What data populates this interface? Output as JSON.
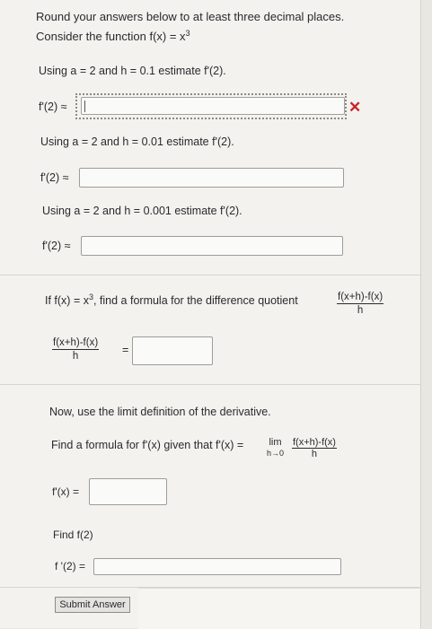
{
  "intro": {
    "line1": "Round your answers below to at least three decimal places.",
    "line2_prefix": "Consider the function f(x) = x",
    "line2_exp": "3"
  },
  "part1": {
    "prompt": "Using a = 2 and h = 0.1 estimate f'(2).",
    "label": "f'(2) ≈",
    "value": "",
    "status_icon": "x-mark",
    "status_color": "#c8232c"
  },
  "part2": {
    "prompt": "Using a = 2 and h = 0.01 estimate f'(2).",
    "label": "f'(2) ≈",
    "value": ""
  },
  "part3": {
    "prompt": "Using a = 2 and h = 0.001 estimate f'(2).",
    "label": "f'(2) ≈",
    "value": ""
  },
  "part4": {
    "prompt_prefix": "If f(x) = x",
    "prompt_exp": "3",
    "prompt_suffix": ", find a formula for the difference quotient",
    "dq_num": "f(x+h)-f(x)",
    "dq_den": "h",
    "equals": "=",
    "value": ""
  },
  "part5": {
    "intro": "Now, use the limit definition of the derivative.",
    "prompt": "Find a formula for f'(x) given that f'(x) =",
    "lim": "lim",
    "lim_sub": "h→0",
    "frac_num": "f(x+h)-f(x)",
    "frac_den": "h",
    "label": "f'(x) =",
    "value": ""
  },
  "part6": {
    "prompt": "Find f(2)",
    "label": "f '(2) =",
    "value": ""
  },
  "submit_label": "Submit Answer"
}
